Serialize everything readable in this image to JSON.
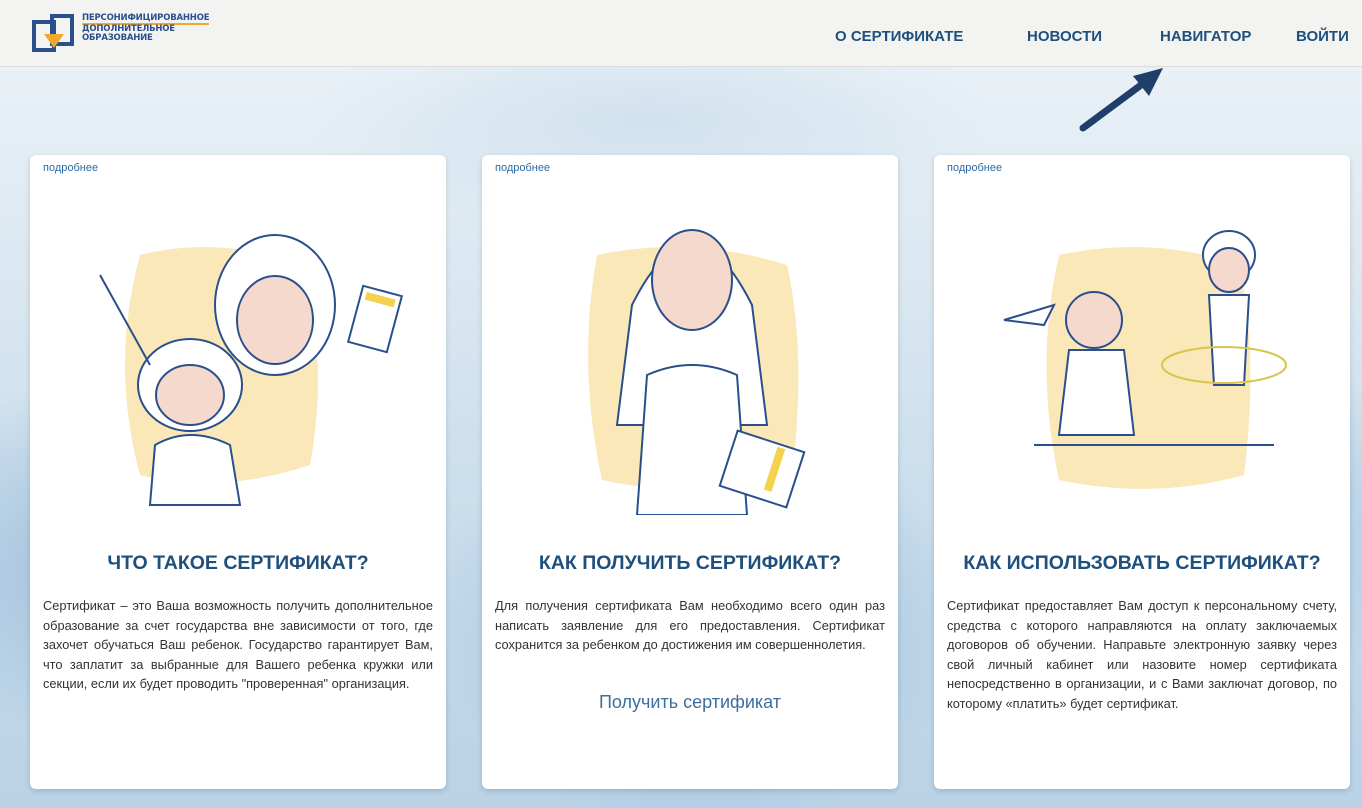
{
  "header": {
    "logo_lines": [
      "ПЕРСОНИФИЦИРОВАННОЕ",
      "ДОПОЛНИТЕЛЬНОЕ",
      "ОБРАЗОВАНИЕ"
    ],
    "nav": [
      "О СЕРТИФИКАТЕ",
      "НОВОСТИ",
      "НАВИГАТОР",
      "ВОЙТИ"
    ]
  },
  "cards": [
    {
      "more": "подробнее",
      "title": "ЧТО ТАКОЕ СЕРТИФИКАТ?",
      "text": "Сертификат – это Ваша возможность получить дополнительное образование за счет государства вне зависимости от того, где захочет обучаться Ваш ребенок. Государство гарантирует Вам, что заплатит за выбранные для Вашего ребенка кружки или секции, если их будет проводить \"проверенная\" организация."
    },
    {
      "more": "подробнее",
      "title": "КАК ПОЛУЧИТЬ СЕРТИФИКАТ?",
      "text": "Для получения сертификата Вам необходимо всего один раз написать заявление для его предоставления. Сертификат сохранится за ребенком до достижения им совершеннолетия.",
      "cta": "Получить сертификат"
    },
    {
      "more": "подробнее",
      "title": "КАК ИСПОЛЬЗОВАТЬ СЕРТИФИКАТ?",
      "text": "Сертификат предоставляет Вам доступ к персональному счету, средства с которого направляются на оплату заключаемых договоров об обучении. Направьте электронную заявку через свой личный кабинет или назовите номер сертификата непосредственно в организации, и с Вами заключат договор, по которому «платить» будет сертификат."
    }
  ],
  "colors": {
    "accent": "#1f4f7d",
    "link": "#2b6aa6",
    "illustration_fill": "#fbe8b8"
  }
}
